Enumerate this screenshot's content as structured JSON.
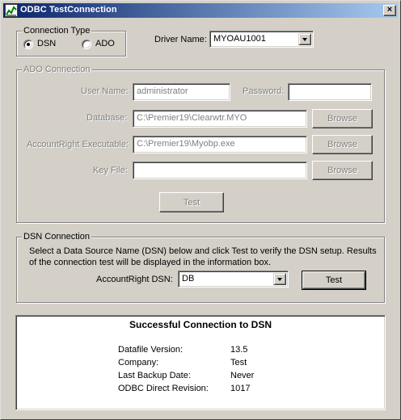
{
  "window": {
    "title": "ODBC TestConnection",
    "close_glyph": "×"
  },
  "connection_type": {
    "legend": "Connection Type",
    "options": [
      {
        "label": "DSN",
        "selected": true
      },
      {
        "label": "ADO",
        "selected": false
      }
    ]
  },
  "driver": {
    "label": "Driver Name:",
    "value": "MYOAU1001"
  },
  "ado": {
    "legend": "ADO Connection",
    "user_name_label": "User Name:",
    "user_name_value": "administrator",
    "password_label": "Password:",
    "password_value": "",
    "database_label": "Database:",
    "database_value": "C:\\Premier19\\Clearwtr.MYO",
    "executable_label": "AccountRight Executable:",
    "executable_value": "C:\\Premier19\\Myobp.exe",
    "key_file_label": "Key File:",
    "key_file_value": "",
    "browse_label": "Browse",
    "test_label": "Test"
  },
  "dsn": {
    "legend": "DSN Connection",
    "description_line1": "Select a Data Source Name (DSN) below and click Test to verify the DSN setup. Results",
    "description_line2": "of the connection test will be displayed in the information box.",
    "dsn_label": "AccountRight DSN:",
    "dsn_value": "DB",
    "test_label": "Test"
  },
  "info": {
    "title": "Successful Connection to DSN",
    "rows": [
      {
        "key": "Datafile Version:",
        "value": "13.5"
      },
      {
        "key": "Company:",
        "value": "Test"
      },
      {
        "key": "Last Backup Date:",
        "value": "Never"
      },
      {
        "key": "ODBC Direct Revision:",
        "value": "1017"
      }
    ]
  },
  "colors": {
    "titlebar_start": "#0a246a",
    "titlebar_end": "#a6caf0",
    "face": "#d4d0c8",
    "disabled_text": "#808080"
  }
}
